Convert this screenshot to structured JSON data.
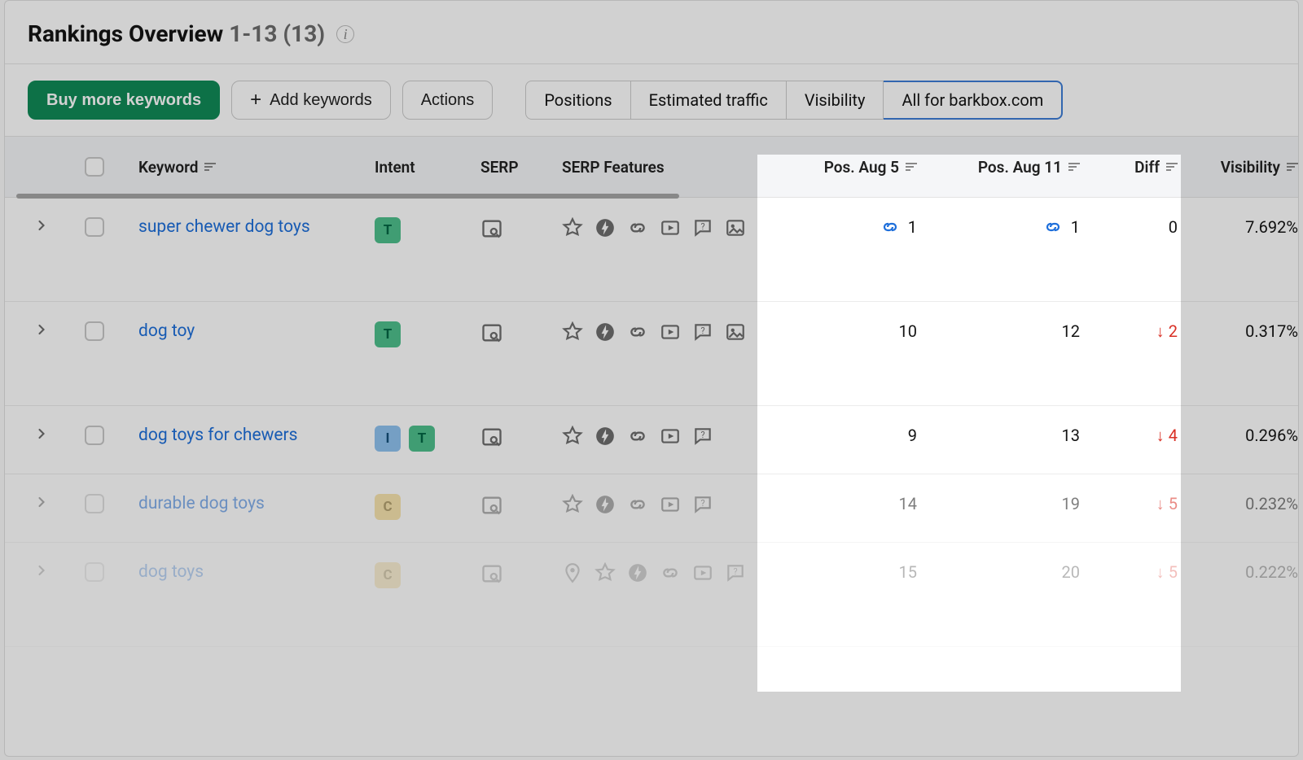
{
  "header": {
    "title": "Rankings Overview",
    "range": "1-13 (13)"
  },
  "toolbar": {
    "buy": "Buy more keywords",
    "add": "Add keywords",
    "actions": "Actions"
  },
  "segments": {
    "positions": "Positions",
    "traffic": "Estimated traffic",
    "visibility": "Visibility",
    "allfor": "All for barkbox.com"
  },
  "columns": {
    "keyword": "Keyword",
    "intent": "Intent",
    "serp": "SERP",
    "features": "SERP Features",
    "posA": "Pos. Aug 5",
    "posB": "Pos. Aug 11",
    "diff": "Diff",
    "visibility": "Visibility"
  },
  "rows": [
    {
      "keyword": "super chewer dog toys",
      "intents": [
        "T"
      ],
      "features": [
        "star",
        "amp",
        "link",
        "video",
        "faq",
        "image"
      ],
      "posA": "1",
      "posA_link": true,
      "posB": "1",
      "posB_link": true,
      "diff": "0",
      "diffDir": "none",
      "visibility": "7.692%",
      "tall": true
    },
    {
      "keyword": "dog toy",
      "intents": [
        "T"
      ],
      "features": [
        "star",
        "amp",
        "link",
        "video",
        "faq",
        "image"
      ],
      "posA": "10",
      "posA_link": false,
      "posB": "12",
      "posB_link": false,
      "diff": "2",
      "diffDir": "down",
      "visibility": "0.317%",
      "tall": true
    },
    {
      "keyword": "dog toys for chewers",
      "intents": [
        "I",
        "T"
      ],
      "features": [
        "star",
        "amp",
        "link",
        "video",
        "faq"
      ],
      "posA": "9",
      "posB": "13",
      "diff": "4",
      "diffDir": "down",
      "visibility": "0.296%",
      "tall": false
    },
    {
      "keyword": "durable dog toys",
      "intents": [
        "C"
      ],
      "features": [
        "star",
        "amp",
        "link",
        "video",
        "faq"
      ],
      "posA": "14",
      "posB": "19",
      "diff": "5",
      "diffDir": "down",
      "visibility": "0.232%",
      "tall": false,
      "fade": "faded"
    },
    {
      "keyword": "dog toys",
      "intents": [
        "C"
      ],
      "features": [
        "pin",
        "star",
        "amp",
        "link",
        "video",
        "faq"
      ],
      "posA": "15",
      "posB": "20",
      "diff": "5",
      "diffDir": "down",
      "visibility": "0.222%",
      "tall": true,
      "fade": "vfaded"
    }
  ]
}
